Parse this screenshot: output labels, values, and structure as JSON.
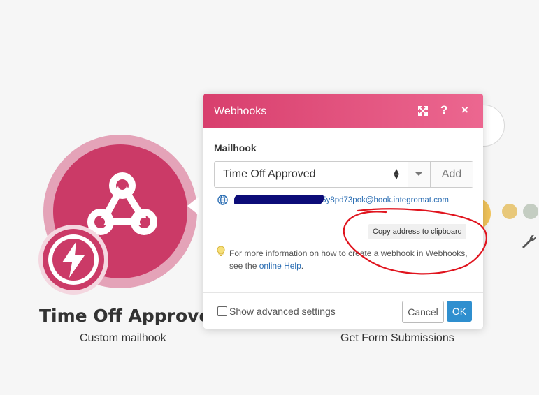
{
  "canvas": {
    "module_title": "Time Off Approved",
    "module_subtitle": "Custom mailhook",
    "module2_subtitle": "Get Form Submissions",
    "module_icon": "webhook-icon",
    "trigger_icon": "lightning-bolt-icon",
    "settings_icon": "wrench-icon"
  },
  "dialog": {
    "title": "Webhooks",
    "header_icons": [
      "expand-icon",
      "help-icon",
      "close-icon"
    ],
    "help_label": "?",
    "close_label": "×",
    "field_label": "Mailhook",
    "selected_hook": "Time Off Approved",
    "add_label": "Add",
    "address_visible": "a1u5y8pd73pok@hook.integromat.com",
    "address_redacted": true,
    "copy_tooltip": "Copy address to clipboard",
    "info_text": "For more information on how to create a webhook in Webhooks, see the",
    "info_link": "online Help",
    "info_suffix": ".",
    "advanced_label": "Show advanced settings",
    "advanced_checked": false,
    "cancel_label": "Cancel",
    "ok_label": "OK"
  },
  "colors": {
    "header_start": "#d83f6d",
    "header_end": "#ec6790",
    "module_pink": "#cb3a67",
    "link_blue": "#2a6db3",
    "ok_blue": "#2f8fcf",
    "annotation_red": "#e0141e"
  }
}
